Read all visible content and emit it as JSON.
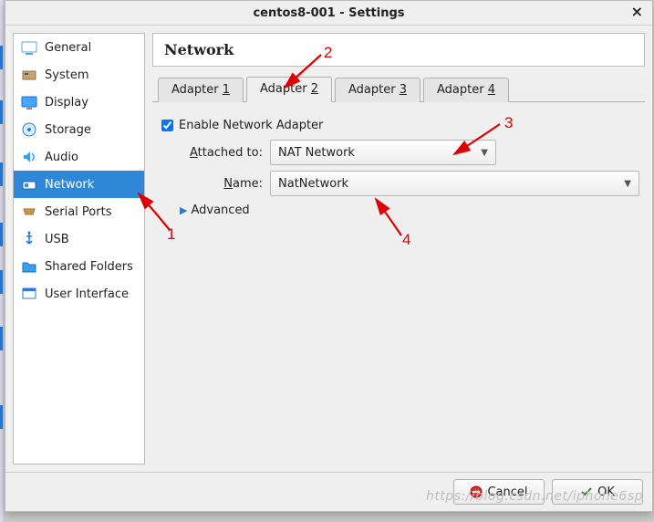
{
  "window": {
    "title": "centos8-001 - Settings"
  },
  "sidebar": {
    "items": [
      {
        "label": "General"
      },
      {
        "label": "System"
      },
      {
        "label": "Display"
      },
      {
        "label": "Storage"
      },
      {
        "label": "Audio"
      },
      {
        "label": "Network"
      },
      {
        "label": "Serial Ports"
      },
      {
        "label": "USB"
      },
      {
        "label": "Shared Folders"
      },
      {
        "label": "User Interface"
      }
    ]
  },
  "panel": {
    "title": "Network"
  },
  "tabs": {
    "prefix": "Adapter ",
    "items": [
      "1",
      "2",
      "3",
      "4"
    ],
    "active_index": 1
  },
  "form": {
    "enable_label": "Enable Network Adapter",
    "enable_checked": true,
    "attached_label_pre": "A",
    "attached_label_post": "ttached to:",
    "attached_value": "NAT Network",
    "name_label_pre": "N",
    "name_label_post": "ame:",
    "name_value": "NatNetwork",
    "advanced_label_pre": "A",
    "advanced_label_post": "dvanced"
  },
  "footer": {
    "cancel": "Cancel",
    "ok": "OK"
  },
  "annotations": {
    "1": "1",
    "2": "2",
    "3": "3",
    "4": "4"
  },
  "watermark": "https://blog.csdn.net/iphone6sp"
}
